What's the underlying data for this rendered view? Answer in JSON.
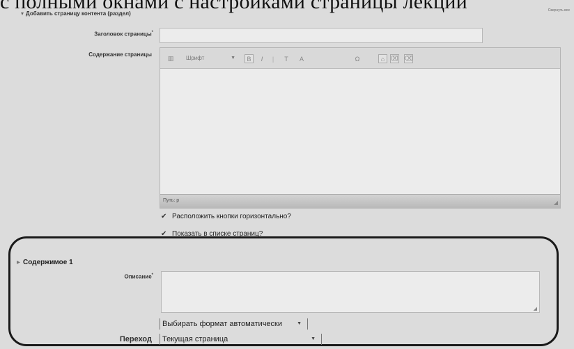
{
  "caption": "с полными окнами с настройками страницы лекции",
  "corner_link": "Свернуть все",
  "section1": {
    "legend": "Добавить страницу контента (раздел)",
    "title_label": "Заголовок страницы",
    "title_value": "",
    "content_label": "Содержание страницы",
    "toolbar": {
      "font_select": "Шрифт",
      "bold": "B",
      "italic": "I",
      "buttons": [
        "T",
        "A",
        "Ω",
        "⌂",
        "⌧",
        "⌫"
      ]
    },
    "status_path": "Путь: p",
    "checkbox_horizontal_label": "Расположить кнопки горизонтально?",
    "checkbox_show_list_label": "Показать в списке страниц?"
  },
  "section2": {
    "legend": "Содержимое 1",
    "description_label": "Описание",
    "description_value": "",
    "format_select": "Выбирать формат автоматически",
    "jump_label": "Переход",
    "jump_value": "Текущая страница"
  },
  "colors": {
    "frame": "#1a1a1a",
    "background": "#dcdcdc"
  }
}
